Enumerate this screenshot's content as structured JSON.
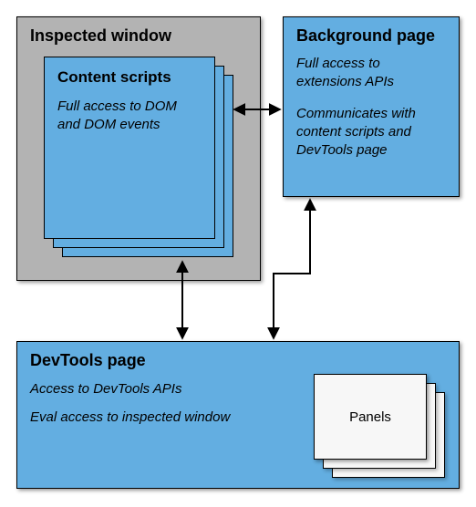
{
  "inspected": {
    "title": "Inspected window"
  },
  "content_scripts": {
    "title": "Content scripts",
    "body": "Full access to DOM and DOM events"
  },
  "background": {
    "title": "Background page",
    "body1": "Full access to extensions APIs",
    "body2": "Communicates with content scripts and DevTools page"
  },
  "devtools": {
    "title": "DevTools page",
    "body1": "Access to DevTools APIs",
    "body2": "Eval access to inspected window"
  },
  "panels": {
    "label": "Panels"
  },
  "colors": {
    "blue": "#63aee1",
    "gray": "#b3b3b3"
  }
}
